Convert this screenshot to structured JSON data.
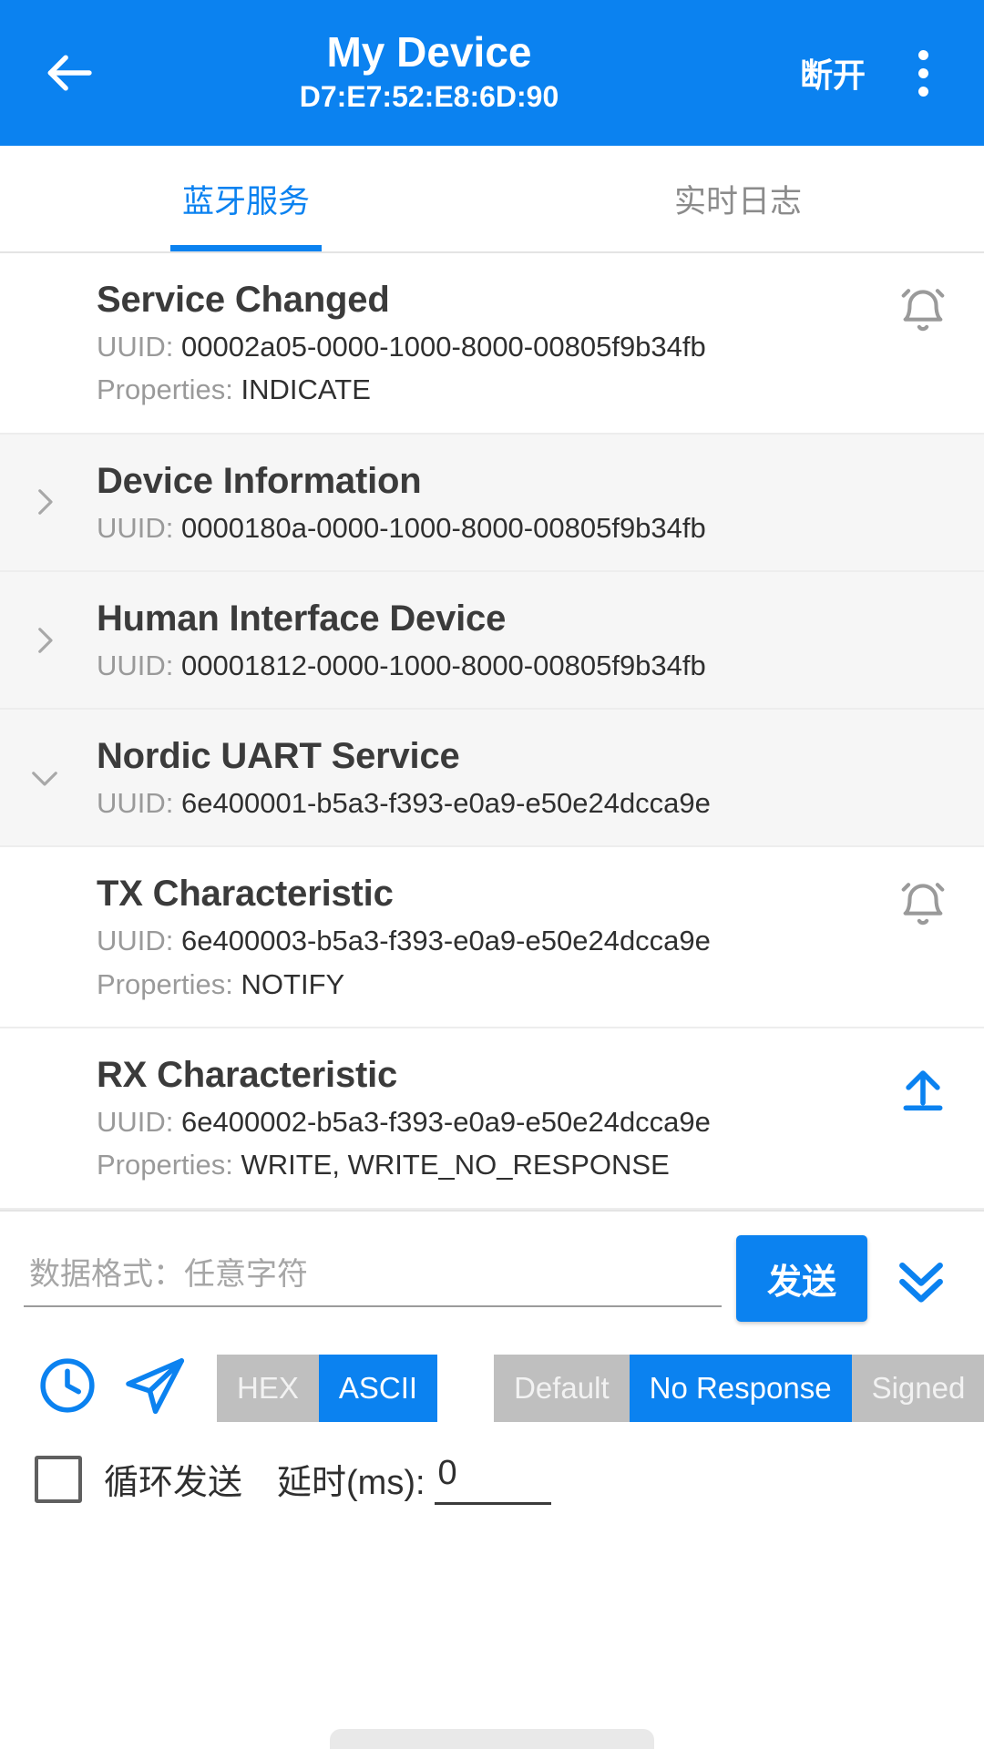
{
  "appbar": {
    "back_icon": "arrow-left-icon",
    "title": "My Device",
    "subtitle": "D7:E7:52:E8:6D:90",
    "action_label": "断开",
    "overflow_icon": "more-vertical-icon"
  },
  "tabs": [
    {
      "label": "蓝牙服务",
      "active": true
    },
    {
      "label": "实时日志",
      "active": false
    }
  ],
  "list": [
    {
      "name": "Service Changed",
      "uuid_label": "UUID:",
      "uuid": "00002a05-0000-1000-8000-00805f9b34fb",
      "props_label": "Properties:",
      "props": "INDICATE",
      "action_icon": "bell-notify-icon",
      "expandable": false,
      "shaded": false
    },
    {
      "name": "Device Information",
      "uuid_label": "UUID:",
      "uuid": "0000180a-0000-1000-8000-00805f9b34fb",
      "props_label": "",
      "props": "",
      "action_icon": "",
      "expandable": true,
      "expanded": false,
      "shaded": true
    },
    {
      "name": "Human Interface Device",
      "uuid_label": "UUID:",
      "uuid": "00001812-0000-1000-8000-00805f9b34fb",
      "props_label": "",
      "props": "",
      "action_icon": "",
      "expandable": true,
      "expanded": false,
      "shaded": true
    },
    {
      "name": "Nordic UART Service",
      "uuid_label": "UUID:",
      "uuid": "6e400001-b5a3-f393-e0a9-e50e24dcca9e",
      "props_label": "",
      "props": "",
      "action_icon": "",
      "expandable": true,
      "expanded": true,
      "shaded": true
    },
    {
      "name": "TX Characteristic",
      "uuid_label": "UUID:",
      "uuid": "6e400003-b5a3-f393-e0a9-e50e24dcca9e",
      "props_label": "Properties:",
      "props": "NOTIFY",
      "action_icon": "bell-notify-icon",
      "expandable": false,
      "shaded": false
    },
    {
      "name": "RX Characteristic",
      "uuid_label": "UUID:",
      "uuid": "6e400002-b5a3-f393-e0a9-e50e24dcca9e",
      "props_label": "Properties:",
      "props": "WRITE, WRITE_NO_RESPONSE",
      "action_icon": "upload-arrow-icon",
      "expandable": false,
      "shaded": false
    }
  ],
  "sendbar": {
    "input_value": "",
    "input_placeholder": "数据格式：任意字符",
    "send_label": "发送",
    "expand_icon": "chevron-double-down-icon"
  },
  "options": {
    "history_icon": "clock-icon",
    "send_icon": "paper-plane-icon",
    "format_segments": [
      {
        "label": "HEX",
        "selected": false
      },
      {
        "label": "ASCII",
        "selected": true
      }
    ],
    "write_segments": [
      {
        "label": "Default",
        "selected": false
      },
      {
        "label": "No Response",
        "selected": true
      },
      {
        "label": "Signed",
        "selected": false
      }
    ]
  },
  "loop": {
    "checked": false,
    "label": "循环发送",
    "delay_label": "延时(ms):",
    "delay_value": "0"
  },
  "colors": {
    "accent": "#0b82f0",
    "segment_off": "#bfbfbf",
    "text_primary": "#3b3b3b",
    "text_secondary": "#9a9a9a"
  }
}
